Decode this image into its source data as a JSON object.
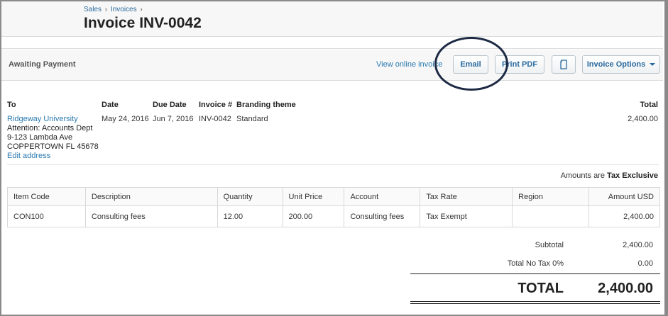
{
  "breadcrumb": {
    "items": [
      "Sales",
      "Invoices"
    ],
    "separator": "›"
  },
  "header": {
    "title": "Invoice INV-0042"
  },
  "actions": {
    "status": "Awaiting Payment",
    "view_online": "View online invoice",
    "email": "Email",
    "print_pdf": "Print PDF",
    "copy_icon": "copy-icon",
    "invoice_options": "Invoice Options"
  },
  "details": {
    "to_label": "To",
    "date_label": "Date",
    "due_date_label": "Due Date",
    "invoice_no_label": "Invoice #",
    "branding_label": "Branding theme",
    "total_label": "Total",
    "contact_name": "Ridgeway University",
    "address_lines": [
      "Attention: Accounts Dept",
      "9-123 Lambda Ave",
      "COPPERTOWN FL 45678"
    ],
    "edit_address": "Edit address",
    "date": "May 24, 2016",
    "due_date": "Jun 7, 2016",
    "invoice_no": "INV-0042",
    "branding": "Standard",
    "total": "2,400.00"
  },
  "amounts_note": {
    "prefix": "Amounts are",
    "mode": "Tax Exclusive"
  },
  "table": {
    "columns": [
      "Item Code",
      "Description",
      "Quantity",
      "Unit Price",
      "Account",
      "Tax Rate",
      "Region",
      "Amount USD"
    ],
    "rows": [
      [
        "CON100",
        "Consulting fees",
        "12.00",
        "200.00",
        "Consulting fees",
        "Tax Exempt",
        "",
        "2,400.00"
      ]
    ]
  },
  "totals": {
    "subtotal_label": "Subtotal",
    "subtotal": "2,400.00",
    "tax_label": "Total No Tax 0%",
    "tax": "0.00",
    "total_label": "TOTAL",
    "total": "2,400.00"
  },
  "colors": {
    "link": "#2a7ab0",
    "highlight_circle": "#1d2a44"
  }
}
